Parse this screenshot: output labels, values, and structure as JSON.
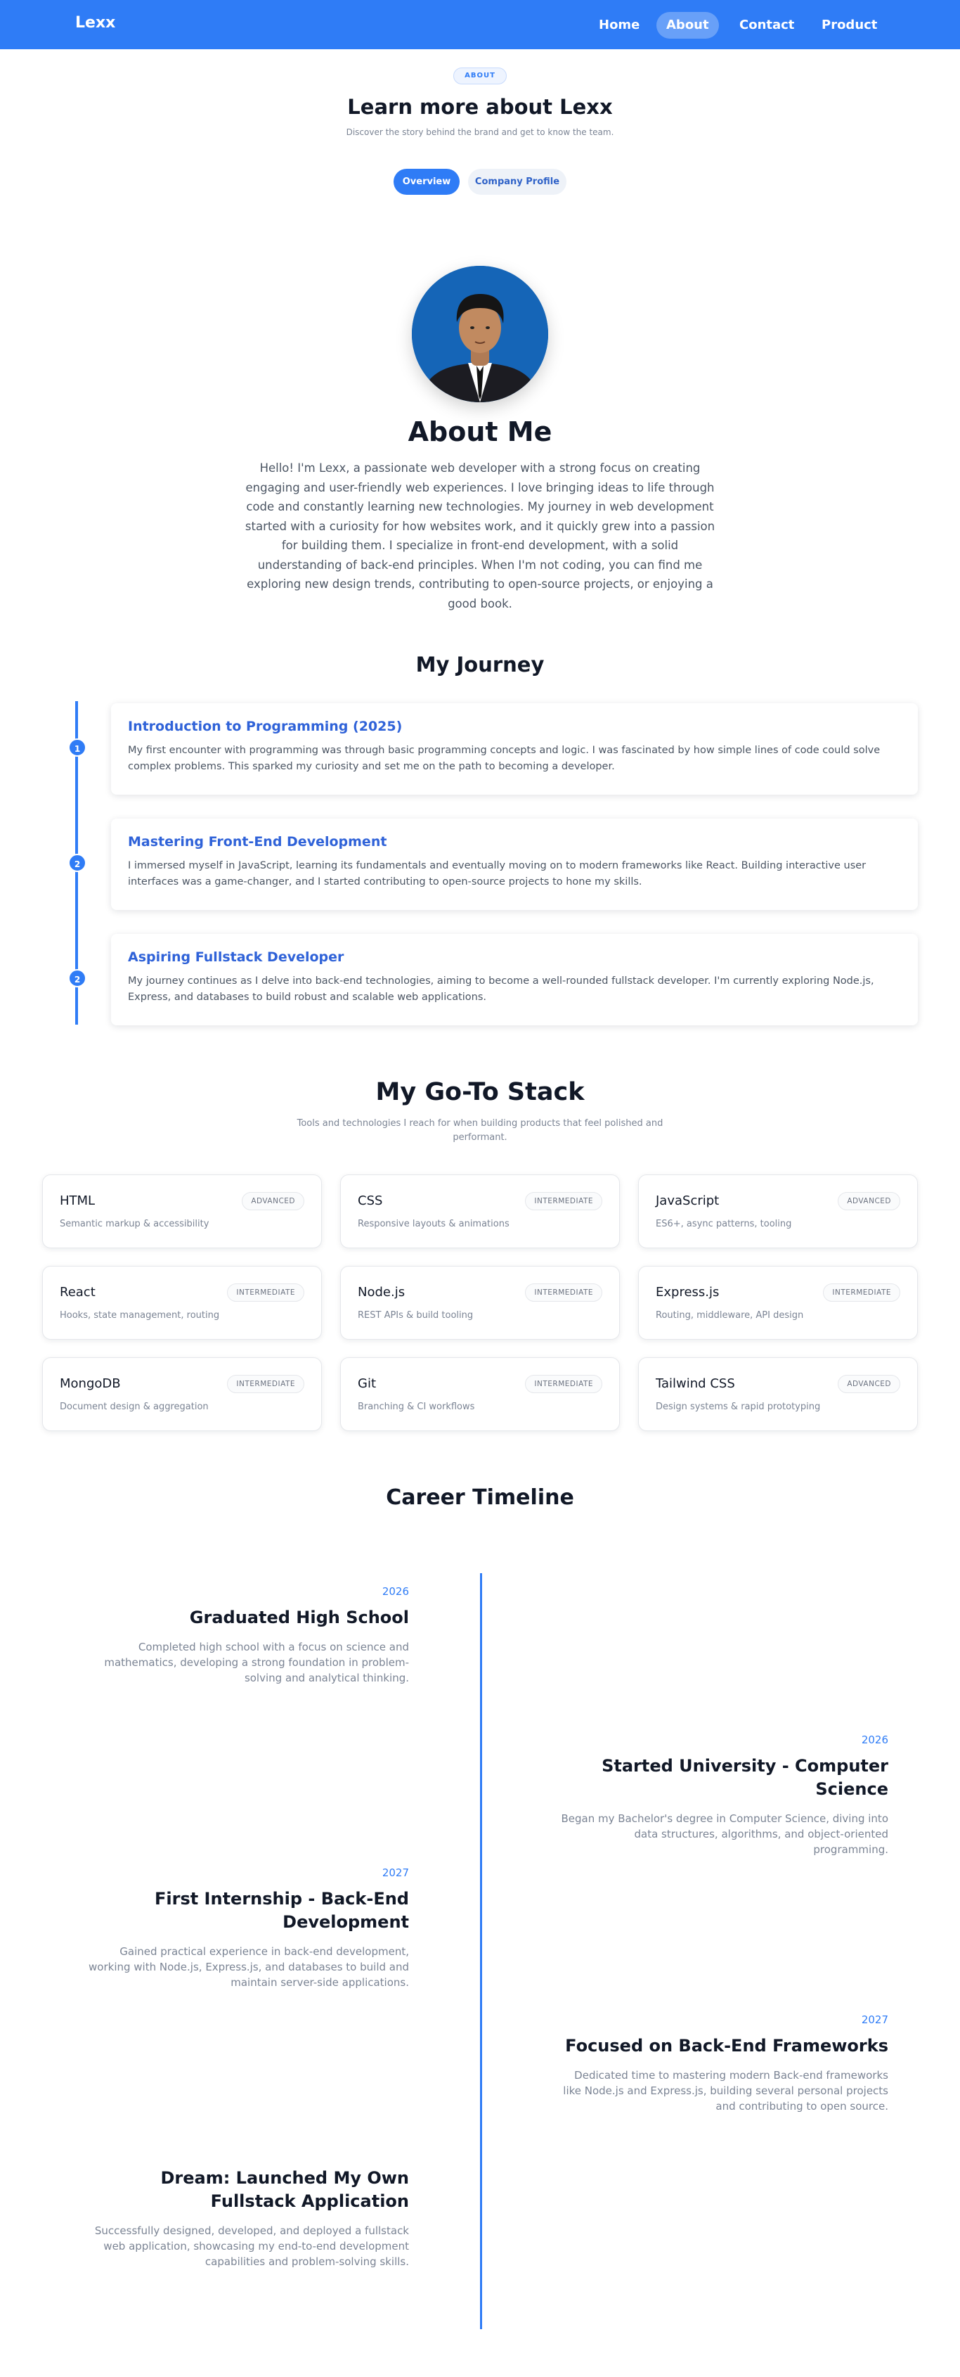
{
  "nav": {
    "brand": "Lexx",
    "links": [
      {
        "label": "Home"
      },
      {
        "label": "About",
        "active": true
      },
      {
        "label": "Contact"
      },
      {
        "label": "Product"
      }
    ]
  },
  "header": {
    "badge": "ABOUT",
    "title": "Learn more about Lexx",
    "subtitle": "Discover the story behind the brand and get to know the team.",
    "tabs": [
      {
        "label": "Overview",
        "active": true
      },
      {
        "label": "Company Profile",
        "active": false
      }
    ]
  },
  "about": {
    "title": "About Me",
    "text": "Hello! I'm Lexx, a passionate web developer with a strong focus on creating engaging and user-friendly web experiences. I love bringing ideas to life through code and constantly learning new technologies. My journey in web development started with a curiosity for how websites work, and it quickly grew into a passion for building them. I specialize in front-end development, with a solid understanding of back-end principles. When I'm not coding, you can find me exploring new design trends, contributing to open-source projects, or enjoying a good book."
  },
  "journey": {
    "title": "My Journey",
    "items": [
      {
        "step": "1",
        "title": "Introduction to Programming (2025)",
        "text": "My first encounter with programming was through basic programming concepts and logic. I was fascinated by how simple lines of code could solve complex problems. This sparked my curiosity and set me on the path to becoming a developer."
      },
      {
        "step": "2",
        "title": "Mastering Front-End Development",
        "text": "I immersed myself in JavaScript, learning its fundamentals and eventually moving on to modern frameworks like React. Building interactive user interfaces was a game-changer, and I started contributing to open-source projects to hone my skills."
      },
      {
        "step": "2",
        "title": "Aspiring Fullstack Developer",
        "text": "My journey continues as I delve into back-end technologies, aiming to become a well-rounded fullstack developer. I'm currently exploring Node.js, Express, and databases to build robust and scalable web applications."
      }
    ]
  },
  "stack": {
    "title": "My Go-To Stack",
    "subtitle": "Tools and technologies I reach for when building products that feel polished and performant.",
    "items": [
      {
        "name": "HTML",
        "level": "ADVANCED",
        "desc": "Semantic markup & accessibility"
      },
      {
        "name": "CSS",
        "level": "INTERMEDIATE",
        "desc": "Responsive layouts & animations"
      },
      {
        "name": "JavaScript",
        "level": "ADVANCED",
        "desc": "ES6+, async patterns, tooling"
      },
      {
        "name": "React",
        "level": "INTERMEDIATE",
        "desc": "Hooks, state management, routing"
      },
      {
        "name": "Node.js",
        "level": "INTERMEDIATE",
        "desc": "REST APIs & build tooling"
      },
      {
        "name": "Express.js",
        "level": "INTERMEDIATE",
        "desc": "Routing, middleware, API design"
      },
      {
        "name": "MongoDB",
        "level": "INTERMEDIATE",
        "desc": "Document design & aggregation"
      },
      {
        "name": "Git",
        "level": "INTERMEDIATE",
        "desc": "Branching & CI workflows"
      },
      {
        "name": "Tailwind CSS",
        "level": "ADVANCED",
        "desc": "Design systems & rapid prototyping"
      }
    ]
  },
  "career": {
    "title": "Career Timeline",
    "items": [
      {
        "year": "2026",
        "title": "Graduated High School",
        "desc": "Completed high school with a focus on science and mathematics, developing a strong foundation in problem-solving and analytical thinking."
      },
      {
        "year": "2026",
        "title": "Started University - Computer Science",
        "desc": "Began my Bachelor's degree in Computer Science, diving into data structures, algorithms, and object-oriented programming."
      },
      {
        "year": "2027",
        "title": "First Internship - Back-End Development",
        "desc": "Gained practical experience in back-end development, working with Node.js, Express.js, and databases to build and maintain server-side applications."
      },
      {
        "year": "2027",
        "title": "Focused on Back-End Frameworks",
        "desc": "Dedicated time to mastering modern Back-end frameworks like Node.js and Express.js, building several personal projects and contributing to open source."
      },
      {
        "title": "Dream: Launched My Own Fullstack Application",
        "desc": "Successfully designed, developed, and deployed a fullstack web application, showcasing my end-to-end development capabilities and problem-solving skills."
      }
    ]
  },
  "colors": {
    "primary": "#2f7cf6",
    "heading": "#111827",
    "muted": "#7b8494"
  }
}
